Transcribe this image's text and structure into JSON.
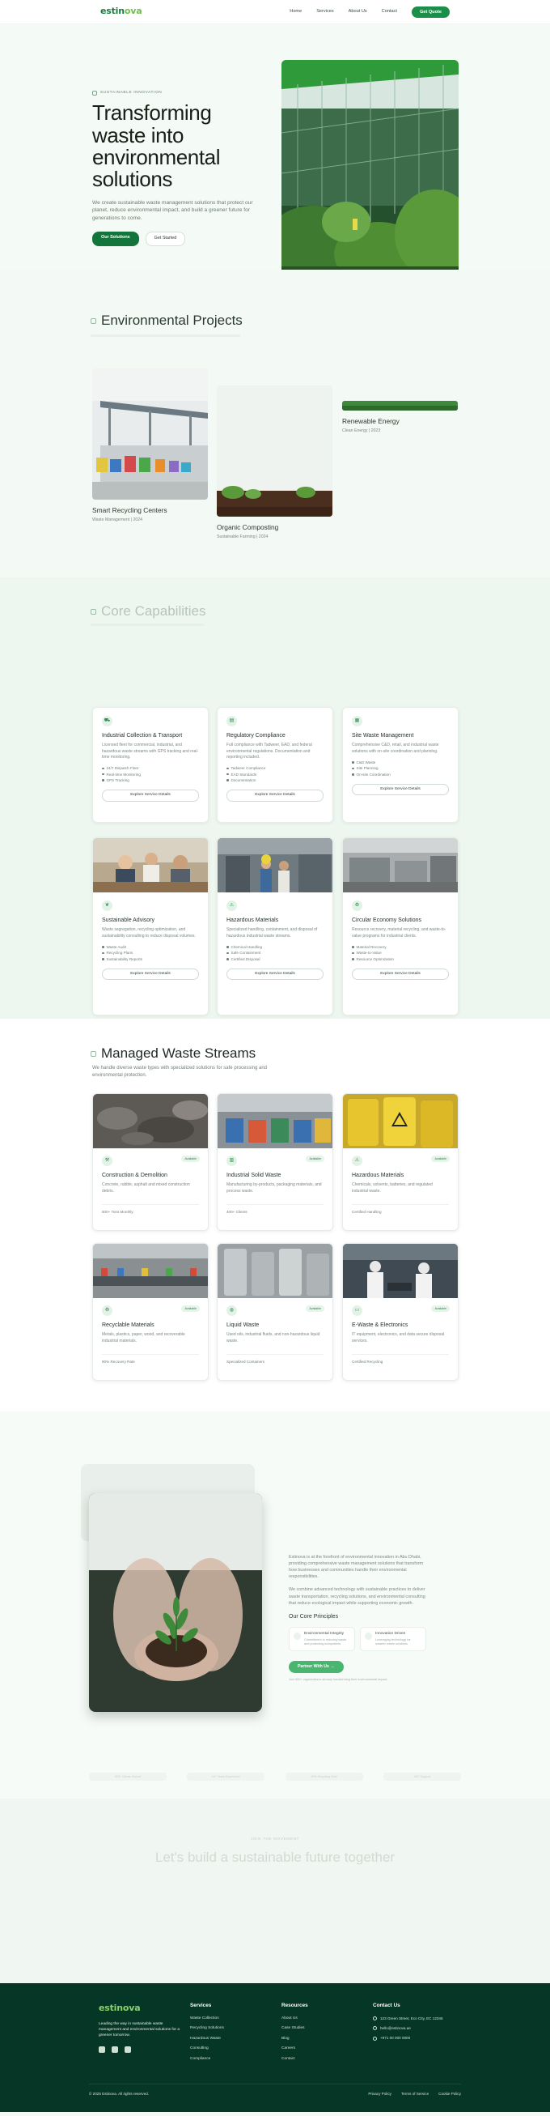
{
  "header": {
    "logo_main": "estin",
    "logo_accent": "ova",
    "nav": [
      "Home",
      "Services",
      "About Us",
      "Contact"
    ],
    "cta": "Get Quote"
  },
  "hero": {
    "eyebrow": "SUSTAINABLE INNOVATION",
    "title": "Transforming waste into environmental solutions",
    "description": "We create sustainable waste management solutions that protect our planet, reduce environmental impact, and build a greener future for generations to come.",
    "primary_button": "Our Solutions",
    "secondary_button": "Get Started"
  },
  "projects": {
    "title": "Environmental Projects",
    "items": [
      {
        "name": "Smart Recycling Centers",
        "meta": "Waste Management | 2024"
      },
      {
        "name": "Organic Composting",
        "meta": "Sustainable Farming | 2024"
      },
      {
        "name": "Renewable Energy",
        "meta": "Clean Energy | 2023"
      }
    ]
  },
  "capabilities": {
    "title": "Core Capabilities",
    "cards": [
      {
        "title": "Industrial Collection & Transport",
        "desc": "Licensed fleet for commercial, industrial, and hazardous waste streams with GPS tracking and real-time monitoring.",
        "bullets": [
          "24/7 Dispatch Fleet",
          "Real-time Monitoring",
          "GPS Tracking"
        ],
        "button": "Explore Service Details"
      },
      {
        "title": "Regulatory Compliance",
        "desc": "Full compliance with Tadweer, EAD, and federal environmental regulations. Documentation and reporting included.",
        "bullets": [
          "Tadweer Compliance",
          "EAD Standards",
          "Documentation"
        ],
        "button": "Explore Service Details"
      },
      {
        "title": "Site Waste Management",
        "desc": "Comprehensive C&D, retail, and industrial waste solutions with on-site coordination and planning.",
        "bullets": [
          "C&D Waste",
          "Site Planning",
          "On-site Coordination"
        ],
        "button": "Explore Service Details"
      },
      {
        "title": "Sustainable Advisory",
        "desc": "Waste segregation, recycling optimization, and sustainability consulting to reduce disposal volumes.",
        "bullets": [
          "Waste Audit",
          "Recycling Plans",
          "Sustainability Reports"
        ],
        "button": "Explore Service Details"
      },
      {
        "title": "Hazardous Materials",
        "desc": "Specialized handling, containment, and disposal of hazardous industrial waste streams.",
        "bullets": [
          "Chemical Handling",
          "Safe Containment",
          "Certified Disposal"
        ],
        "button": "Explore Service Details"
      },
      {
        "title": "Circular Economy Solutions",
        "desc": "Resource recovery, material recycling, and waste-to-value programs for industrial clients.",
        "bullets": [
          "Material Recovery",
          "Waste-to-Value",
          "Resource Optimization"
        ],
        "button": "Explore Service Details"
      }
    ]
  },
  "waste": {
    "title": "Managed Waste Streams",
    "subtitle": "We handle diverse waste types with specialized solutions for safe processing and environmental protection.",
    "badge": "Available",
    "items": [
      {
        "title": "Construction & Demolition",
        "desc": "Concrete, rubble, asphalt and mixed construction debris.",
        "footer": "500+ Tons Monthly"
      },
      {
        "title": "Industrial Solid Waste",
        "desc": "Manufacturing by-products, packaging materials, and process waste.",
        "footer": "400+ Clients"
      },
      {
        "title": "Hazardous Materials",
        "desc": "Chemicals, solvents, batteries, and regulated industrial waste.",
        "footer": "Certified Handling"
      },
      {
        "title": "Recyclable Materials",
        "desc": "Metals, plastics, paper, wood, and recoverable industrial materials.",
        "footer": "90% Recovery Rate"
      },
      {
        "title": "Liquid Waste",
        "desc": "Used oils, industrial fluids, and non-hazardous liquid waste.",
        "footer": "Specialized Containers"
      },
      {
        "title": "E-Waste & Electronics",
        "desc": "IT equipment, electronics, and data secure disposal services.",
        "footer": "Certified Recycling"
      }
    ]
  },
  "about": {
    "p1": "Estinova is at the forefront of environmental innovation in Abu Dhabi, providing comprehensive waste management solutions that transform how businesses and communities handle their environmental responsibilities.",
    "p2": "We combine advanced technology with sustainable practices to deliver waste transportation, recycling solutions, and environmental consulting that reduce ecological impact while supporting economic growth.",
    "principles_title": "Our Core Principles",
    "principles": [
      {
        "name": "Environmental Integrity",
        "desc": "Commitment to reducing waste and protecting ecosystems"
      },
      {
        "name": "Innovation Driven",
        "desc": "Leveraging technology for smarter waste solutions"
      }
    ],
    "button": "Partner With Us",
    "note": "Join 500+ organizations already transforming their environmental impact.",
    "stats": [
      "500+ Clients Served",
      "10+ Years Experience",
      "90% Recycling Rate",
      "24/7 Support"
    ]
  },
  "cta": {
    "eyebrow": "JOIN THE MOVEMENT",
    "title": "Let's build a sustainable future together"
  },
  "footer": {
    "tagline": "Leading the way in sustainable waste management and environmental solutions for a greener tomorrow.",
    "services_title": "Services",
    "services": [
      "Waste Collection",
      "Recycling Solutions",
      "Hazardous Waste",
      "Consulting",
      "Compliance"
    ],
    "resources_title": "Resources",
    "resources": [
      "About Us",
      "Case Studies",
      "Blog",
      "Careers",
      "Contact"
    ],
    "contact_title": "Contact Us",
    "contact": [
      "123 Green Street, Eco City, EC 12345",
      "hello@estinova.ae",
      "+971 00 000 0000"
    ],
    "copyright": "© 2025 Estinova. All rights reserved.",
    "legal": [
      "Privacy Policy",
      "Terms of Service",
      "Cookie Policy"
    ]
  },
  "colors": {
    "brand": "#1a8f4a",
    "footer_bg": "#063625",
    "accent": "#6cc04a"
  }
}
